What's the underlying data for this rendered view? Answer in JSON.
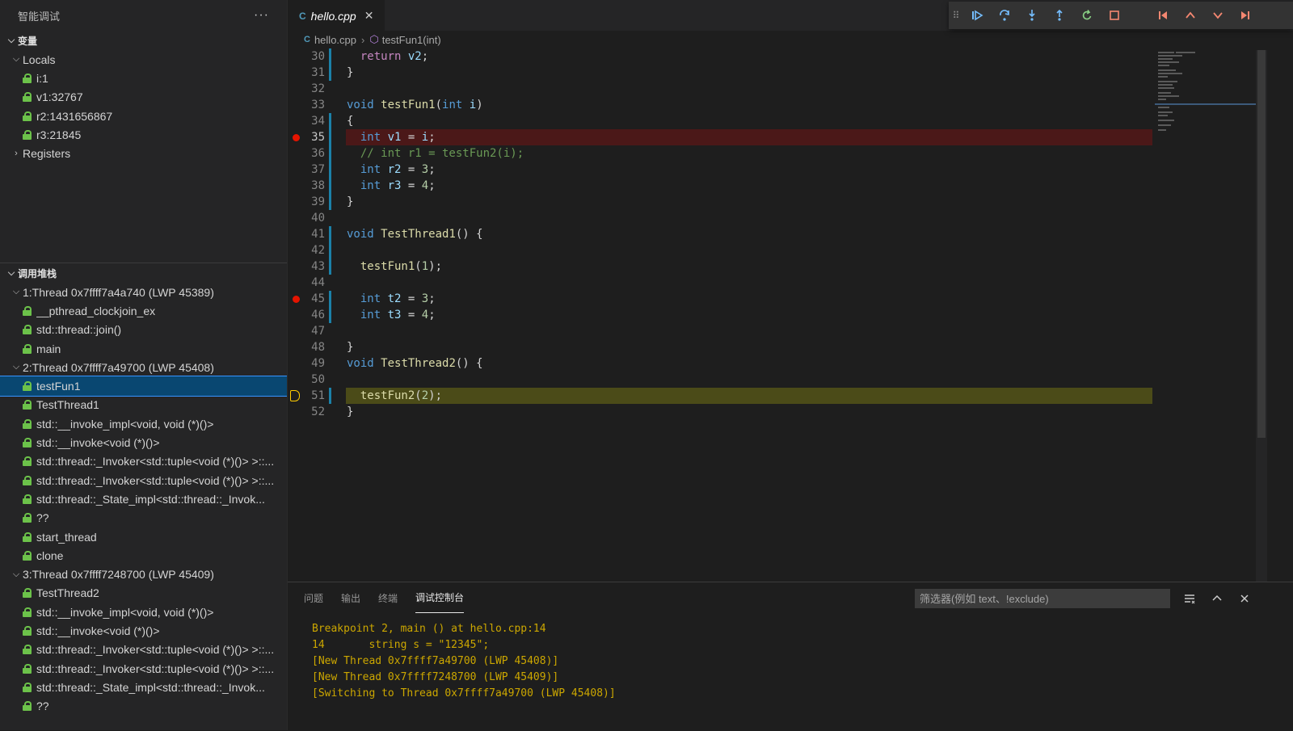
{
  "sidebar": {
    "title": "智能调试",
    "more": "···",
    "variables_title": "变量",
    "locals_label": "Locals",
    "locals": [
      "i:1",
      "v1:32767",
      "r2:1431656867",
      "r3:21845"
    ],
    "registers_label": "Registers",
    "callstack_title": "调用堆栈",
    "threads": [
      {
        "label": "1:Thread 0x7ffff7a4a740 (LWP 45389)",
        "frames": [
          "__pthread_clockjoin_ex",
          "std::thread::join()",
          "main"
        ]
      },
      {
        "label": "2:Thread 0x7ffff7a49700 (LWP 45408)",
        "frames": [
          "testFun1",
          "TestThread1",
          "std::__invoke_impl<void, void (*)()>",
          "std::__invoke<void (*)()>",
          "std::thread::_Invoker<std::tuple<void (*)()> >::...",
          "std::thread::_Invoker<std::tuple<void (*)()> >::...",
          "std::thread::_State_impl<std::thread::_Invok...",
          "??",
          "start_thread",
          "clone"
        ]
      },
      {
        "label": "3:Thread 0x7ffff7248700 (LWP 45409)",
        "frames": [
          "TestThread2",
          "std::__invoke_impl<void, void (*)()>",
          "std::__invoke<void (*)()>",
          "std::thread::_Invoker<std::tuple<void (*)()> >::...",
          "std::thread::_Invoker<std::tuple<void (*)()> >::...",
          "std::thread::_State_impl<std::thread::_Invok...",
          "??"
        ]
      }
    ]
  },
  "editor": {
    "tab_icon": "C",
    "tab_name": "hello.cpp",
    "tab_close": "✕",
    "breadcrumb": {
      "file": "hello.cpp",
      "symbol": "testFun1(int)"
    },
    "lines": [
      {
        "n": "30",
        "t": "  return v2;"
      },
      {
        "n": "31",
        "t": "}"
      },
      {
        "n": "32",
        "t": ""
      },
      {
        "n": "33",
        "t": "void testFun1(int i)"
      },
      {
        "n": "34",
        "t": "{"
      },
      {
        "n": "35",
        "t": "  int v1 = i;"
      },
      {
        "n": "36",
        "t": "  // int r1 = testFun2(i);"
      },
      {
        "n": "37",
        "t": "  int r2 = 3;"
      },
      {
        "n": "38",
        "t": "  int r3 = 4;"
      },
      {
        "n": "39",
        "t": "}"
      },
      {
        "n": "40",
        "t": ""
      },
      {
        "n": "41",
        "t": "void TestThread1() {"
      },
      {
        "n": "42",
        "t": ""
      },
      {
        "n": "43",
        "t": "  testFun1(1);"
      },
      {
        "n": "44",
        "t": ""
      },
      {
        "n": "45",
        "t": "  int t2 = 3;"
      },
      {
        "n": "46",
        "t": "  int t3 = 4;"
      },
      {
        "n": "47",
        "t": ""
      },
      {
        "n": "48",
        "t": "}"
      },
      {
        "n": "49",
        "t": "void TestThread2() {"
      },
      {
        "n": "50",
        "t": ""
      },
      {
        "n": "51",
        "t": "  testFun2(2);"
      },
      {
        "n": "52",
        "t": "}"
      }
    ]
  },
  "debug_toolbar": [
    "continue-icon",
    "step-over-icon",
    "step-into-icon",
    "step-out-icon",
    "restart-icon",
    "stop-icon",
    "go-start-icon",
    "prev-icon",
    "next-icon",
    "go-end-icon"
  ],
  "panel": {
    "tabs": [
      "问题",
      "输出",
      "终端",
      "调试控制台"
    ],
    "filter_placeholder": "筛选器(例如 text、!exclude)",
    "console": [
      "Breakpoint 2, main () at hello.cpp:14",
      "14       string s = \"12345\";",
      "[New Thread 0x7ffff7a49700 (LWP 45408)]",
      "[New Thread 0x7ffff7248700 (LWP 45409)]",
      "[Switching to Thread 0x7ffff7a49700 (LWP 45408)]"
    ]
  },
  "colors": {
    "accent": "#3794ff",
    "selection": "#094771",
    "breakpoint": "#e51400",
    "console": "#cca700"
  }
}
